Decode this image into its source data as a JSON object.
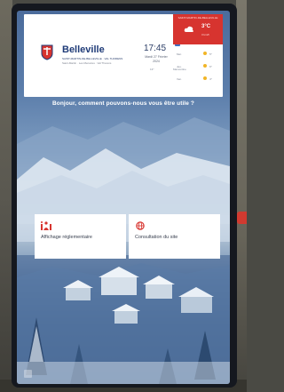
{
  "header": {
    "brand": "Belleville",
    "brand_sub": "SAINT-MARTIN-DE-BELLEVILLE · VAL THORENS",
    "brand_sub2": "Saint-Martin · Les Menuires · Val Thorens",
    "clock": "17:45",
    "date_line1": "Mardi 27 Février",
    "date_line2": "2024",
    "mini_info_a": "13°",
    "mini_info_b": "Mamontine"
  },
  "weather": {
    "title": "SAINT-MARTIN-DE-BELLEVILLE",
    "temp": "3°C",
    "wind": "3 km/h",
    "forecast": [
      {
        "day": "Mer.",
        "temp": "5°"
      },
      {
        "day": "Jeu.",
        "temp": "6°"
      },
      {
        "day": "Ven.",
        "temp": "4°"
      }
    ]
  },
  "main": {
    "greeting": "Bonjour, comment pouvons-nous vous être utile ?",
    "tiles": [
      {
        "label": "Affichage réglementaire",
        "icon": "info-people-icon"
      },
      {
        "label": "Consultation du site",
        "icon": "globe-icon"
      }
    ]
  },
  "colors": {
    "accent_red": "#d7342f",
    "brand_blue": "#1f3b78",
    "tile_icon_red": "#d7342f"
  }
}
